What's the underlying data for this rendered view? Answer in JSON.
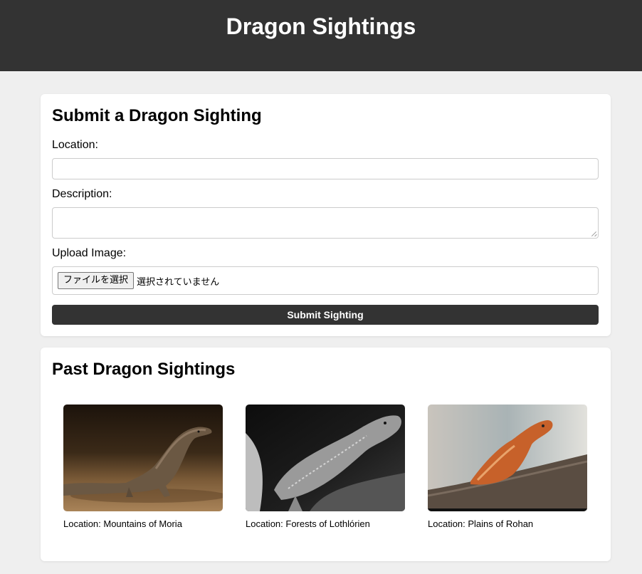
{
  "header": {
    "title": "Dragon Sightings"
  },
  "form": {
    "title": "Submit a Dragon Sighting",
    "location_label": "Location:",
    "location_value": "",
    "description_label": "Description:",
    "description_value": "",
    "upload_label": "Upload Image:",
    "file_button": "ファイルを選択",
    "file_status": "選択されていません",
    "submit_label": "Submit Sighting"
  },
  "past": {
    "title": "Past Dragon Sightings",
    "sightings": [
      {
        "caption": "Location: Mountains of Moria",
        "photo": "monitor-lizard-photo"
      },
      {
        "caption": "Location: Forests of Lothlórien",
        "photo": "bearded-dragon-bw-photo"
      },
      {
        "caption": "Location: Plains of Rohan",
        "photo": "bearded-dragon-color-photo"
      }
    ]
  },
  "colors": {
    "header_bg": "#333333",
    "page_bg": "#efefef",
    "button_bg": "#333333"
  }
}
